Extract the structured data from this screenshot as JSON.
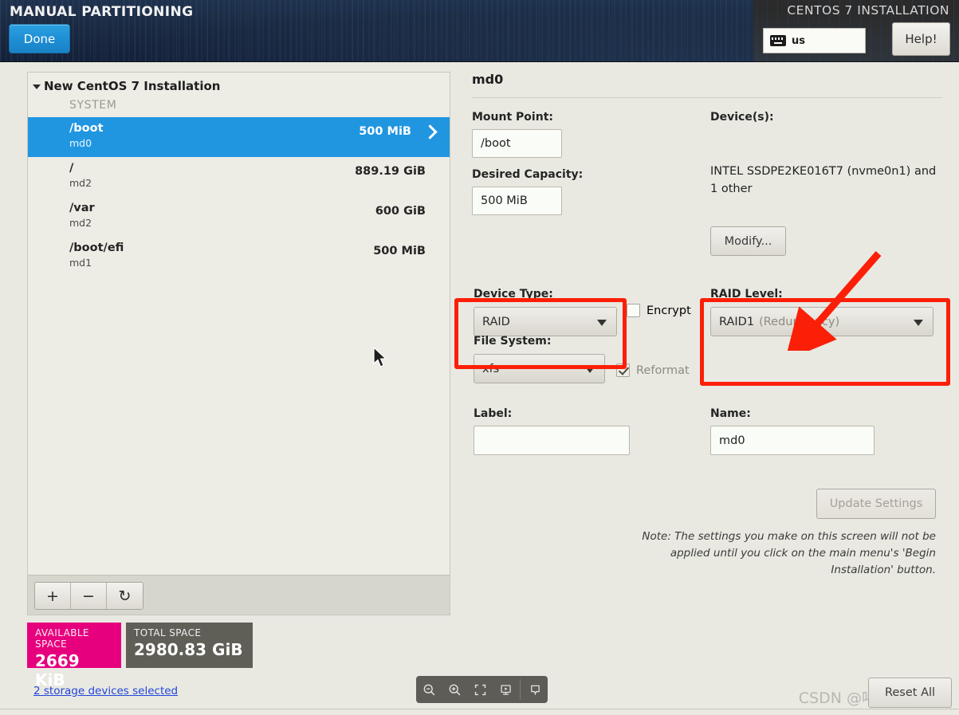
{
  "header": {
    "title": "MANUAL PARTITIONING",
    "done_label": "Done",
    "install_title": "CENTOS 7 INSTALLATION",
    "keyboard_layout": "us",
    "keyboard_icon": "keyboard-icon",
    "help_label": "Help!"
  },
  "left_panel": {
    "tree_root_label": "New CentOS 7 Installation",
    "group_label": "SYSTEM",
    "partitions": [
      {
        "mount": "/boot",
        "device": "md0",
        "size": "500 MiB",
        "selected": true
      },
      {
        "mount": "/",
        "device": "md2",
        "size": "889.19 GiB",
        "selected": false
      },
      {
        "mount": "/var",
        "device": "md2",
        "size": "600 GiB",
        "selected": false
      },
      {
        "mount": "/boot/efi",
        "device": "md1",
        "size": "500 MiB",
        "selected": false
      }
    ],
    "footer_buttons": [
      {
        "name": "add-partition-button",
        "glyph": "+"
      },
      {
        "name": "remove-partition-button",
        "glyph": "−"
      },
      {
        "name": "reload-button",
        "glyph": "↻"
      }
    ]
  },
  "space": {
    "available_caption": "AVAILABLE SPACE",
    "available_value": "2669 KiB",
    "available_color": "#e6007e",
    "total_caption": "TOTAL SPACE",
    "total_value": "2980.83 GiB",
    "total_color": "#5f5e57",
    "storage_link": "2 storage devices selected"
  },
  "details": {
    "title": "md0",
    "mount_point_label": "Mount Point:",
    "mount_point_value": "/boot",
    "desired_capacity_label": "Desired Capacity:",
    "desired_capacity_value": "500 MiB",
    "devices_label": "Device(s):",
    "devices_value": "INTEL SSDPE2KE016T7 (nvme0n1) and 1 other",
    "modify_label": "Modify...",
    "device_type_label": "Device Type:",
    "device_type_value": "RAID",
    "encrypt_label": "Encrypt",
    "encrypt_checked": false,
    "file_system_label": "File System:",
    "file_system_value": "xfs",
    "reformat_label": "Reformat",
    "reformat_checked": true,
    "raid_level_label": "RAID Level:",
    "raid_level_value": "RAID1",
    "raid_level_suffix": "(Redundancy)",
    "label_label": "Label:",
    "label_value": "",
    "name_label": "Name:",
    "name_value": "md0",
    "update_settings_label": "Update Settings",
    "note_text": "Note:  The settings you make on this screen will not be applied until you click on the main menu's 'Begin Installation' button."
  },
  "annotations": {
    "highlight_color": "#fb1f08",
    "boxes": [
      "device-type-highlight",
      "raid-level-highlight"
    ],
    "arrow": "red-arrow-pointing-to-raid-level"
  },
  "bottom": {
    "viewer_icons": [
      "zoom-out-icon",
      "zoom-in-icon",
      "fit-screen-icon",
      "present-icon",
      "pin-icon"
    ],
    "reset_all_label": "Reset All",
    "watermark": "CSDN @喝醉酒的小白"
  }
}
